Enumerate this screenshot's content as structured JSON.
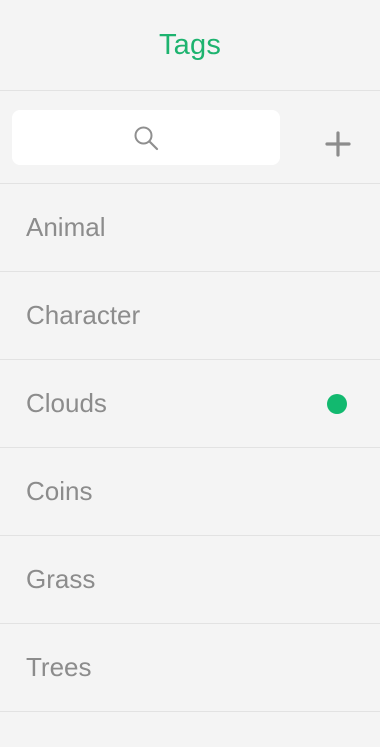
{
  "header": {
    "title": "Tags"
  },
  "search": {
    "icon": "search-icon",
    "add_icon": "plus-icon"
  },
  "tags": [
    {
      "label": "Animal",
      "selected": false
    },
    {
      "label": "Character",
      "selected": false
    },
    {
      "label": "Clouds",
      "selected": true
    },
    {
      "label": "Coins",
      "selected": false
    },
    {
      "label": "Grass",
      "selected": false
    },
    {
      "label": "Trees",
      "selected": false
    }
  ],
  "colors": {
    "accent": "#1db36f",
    "selected_dot": "#12b96f",
    "text": "#8c8c8c",
    "background": "#f4f4f4",
    "divider": "#e2e2e2"
  }
}
